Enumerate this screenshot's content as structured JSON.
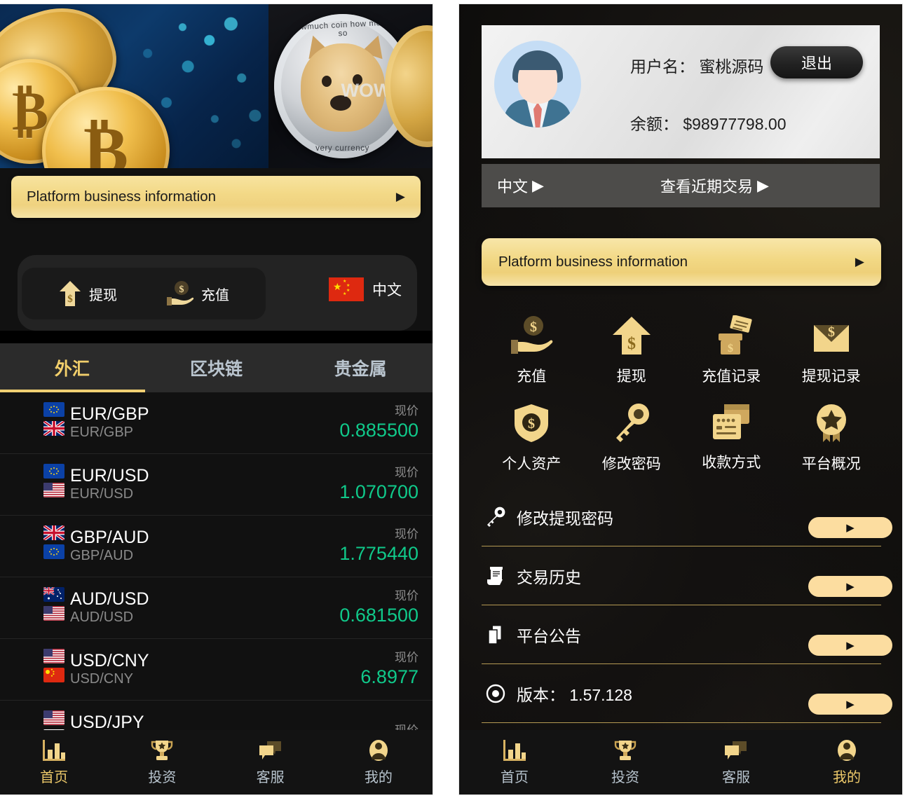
{
  "left_panel": {
    "hero": {
      "left_image_alt": "bitcoin-coins-photo",
      "right_image_alt": "dogecoin-coin-photo",
      "doge_rim_top": "wowmuch coin how money so",
      "doge_rim_bottom": "very currency",
      "doge_wow": "WOW"
    },
    "banner": {
      "label": "Platform business information",
      "arrow": "▶"
    },
    "actions": [
      {
        "name": "withdraw",
        "label": "提现",
        "icon": "up-arrow-dollar-icon"
      },
      {
        "name": "recharge",
        "label": "充值",
        "icon": "hand-coin-icon"
      }
    ],
    "language": {
      "label": "中文",
      "flag": "cn-flag-icon"
    },
    "tabs": [
      {
        "label": "外汇",
        "active": true
      },
      {
        "label": "区块链",
        "active": false
      },
      {
        "label": "贵金属",
        "active": false
      }
    ],
    "price_caption": "现价",
    "rows": [
      {
        "pair": "EUR/GBP",
        "sub": "EUR/GBP",
        "price": "0.885500",
        "flag_top": "eu",
        "flag_bottom": "gb"
      },
      {
        "pair": "EUR/USD",
        "sub": "EUR/USD",
        "price": "1.070700",
        "flag_top": "eu",
        "flag_bottom": "us"
      },
      {
        "pair": "GBP/AUD",
        "sub": "GBP/AUD",
        "price": "1.775440",
        "flag_top": "gb",
        "flag_bottom": "eu"
      },
      {
        "pair": "AUD/USD",
        "sub": "AUD/USD",
        "price": "0.681500",
        "flag_top": "au",
        "flag_bottom": "us"
      },
      {
        "pair": "USD/CNY",
        "sub": "USD/CNY",
        "price": "6.8977",
        "flag_top": "us",
        "flag_bottom": "cn"
      },
      {
        "pair": "USD/JPY",
        "sub": "USD/JPY",
        "price": "",
        "flag_top": "us",
        "flag_bottom": "jp"
      }
    ],
    "bottom_nav": [
      {
        "label": "首页",
        "icon": "bar-chart-icon",
        "active": true
      },
      {
        "label": "投资",
        "icon": "trophy-icon",
        "active": false
      },
      {
        "label": "客服",
        "icon": "chat-bubbles-icon",
        "active": false
      },
      {
        "label": "我的",
        "icon": "user-icon",
        "active": false
      }
    ]
  },
  "right_panel": {
    "profile": {
      "username_line": "用户名： 蜜桃源码",
      "balance_line": "余额： $98977798.00",
      "logout_label": "退出",
      "avatar_icon": "avatar-icon"
    },
    "sub_bar": {
      "language_label": "中文",
      "language_arrow": "▶",
      "recent_label": "查看近期交易",
      "recent_arrow": "▶"
    },
    "banner": {
      "label": "Platform business information",
      "arrow": "▶"
    },
    "grid": [
      {
        "label": "充值",
        "icon": "hand-coin-icon"
      },
      {
        "label": "提现",
        "icon": "up-arrow-dollar-icon"
      },
      {
        "label": "充值记录",
        "icon": "deposit-box-icon"
      },
      {
        "label": "提现记录",
        "icon": "envelope-dollar-icon"
      },
      {
        "label": "个人资产",
        "icon": "shield-dollar-icon"
      },
      {
        "label": "修改密码",
        "icon": "key-icon"
      },
      {
        "label": "收款方式",
        "icon": "cards-icon"
      },
      {
        "label": "平台概况",
        "icon": "badge-star-icon"
      }
    ],
    "rows": [
      {
        "label": "修改提现密码",
        "icon": "key-icon",
        "arrow": "▶"
      },
      {
        "label": "交易历史",
        "icon": "receipt-icon",
        "arrow": "▶"
      },
      {
        "label": "平台公告",
        "icon": "announcement-icon",
        "arrow": "▶"
      },
      {
        "label": "版本： 1.57.128",
        "icon": "target-icon",
        "arrow": "▶"
      }
    ],
    "bottom_nav": [
      {
        "label": "首页",
        "icon": "bar-chart-icon",
        "active": false
      },
      {
        "label": "投资",
        "icon": "trophy-icon",
        "active": false
      },
      {
        "label": "客服",
        "icon": "chat-bubbles-icon",
        "active": false
      },
      {
        "label": "我的",
        "icon": "user-icon",
        "active": true
      }
    ]
  },
  "colors": {
    "gold": "#f0cf72",
    "price_green": "#10c98a",
    "nav_inactive": "#b7c3cd",
    "panel_bg": "#111111"
  }
}
